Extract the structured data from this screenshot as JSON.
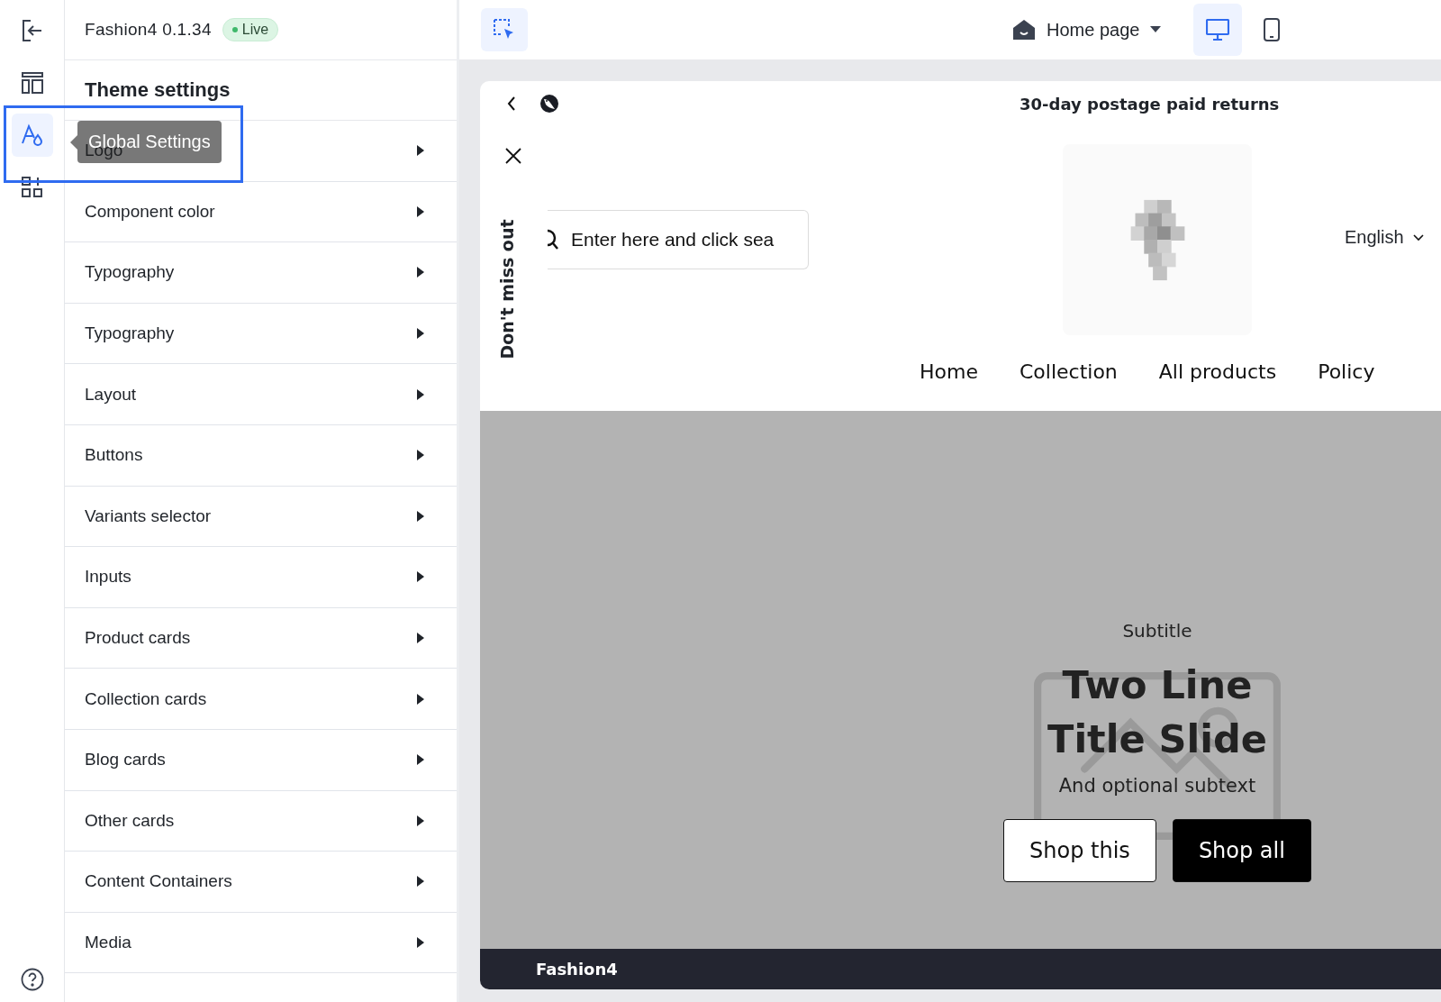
{
  "rail": {
    "items": [
      {
        "kind": "exit",
        "selected": false
      },
      {
        "kind": "layout",
        "selected": false
      },
      {
        "kind": "global",
        "selected": true
      },
      {
        "kind": "add",
        "selected": false
      }
    ],
    "help": {
      "kind": "help"
    }
  },
  "tooltip": {
    "text": "Global Settings"
  },
  "sidebar": {
    "app_name": "Fashion4 0.1.34",
    "status": "Live",
    "title": "Theme settings",
    "items": [
      {
        "label": "Logo"
      },
      {
        "label": "Component color"
      },
      {
        "label": "Typography"
      },
      {
        "label": "Typography"
      },
      {
        "label": "Layout"
      },
      {
        "label": "Buttons"
      },
      {
        "label": "Variants selector"
      },
      {
        "label": "Inputs"
      },
      {
        "label": "Product cards"
      },
      {
        "label": "Collection cards"
      },
      {
        "label": "Blog cards"
      },
      {
        "label": "Other cards"
      },
      {
        "label": "Content Containers"
      },
      {
        "label": "Media"
      }
    ]
  },
  "toolbar": {
    "page": "Home page",
    "devices": [
      {
        "kind": "desktop",
        "selected": true
      },
      {
        "kind": "mobile",
        "selected": false
      }
    ]
  },
  "preview": {
    "announcement": "30-day postage paid returns",
    "popup_tab": "Don't miss out",
    "search": {
      "placeholder": "Enter here and click sea"
    },
    "language": "English",
    "nav": [
      "Home",
      "Collection",
      "All products",
      "Policy"
    ],
    "hero": {
      "subtitle": "Subtitle",
      "title_lines": [
        "Two Line",
        "Title Slide"
      ],
      "subtext": "And optional subtext",
      "buttons": [
        {
          "label": "Shop this",
          "kind": "secondary"
        },
        {
          "label": "Shop all",
          "kind": "primary"
        }
      ]
    },
    "footer": "Fashion4"
  }
}
